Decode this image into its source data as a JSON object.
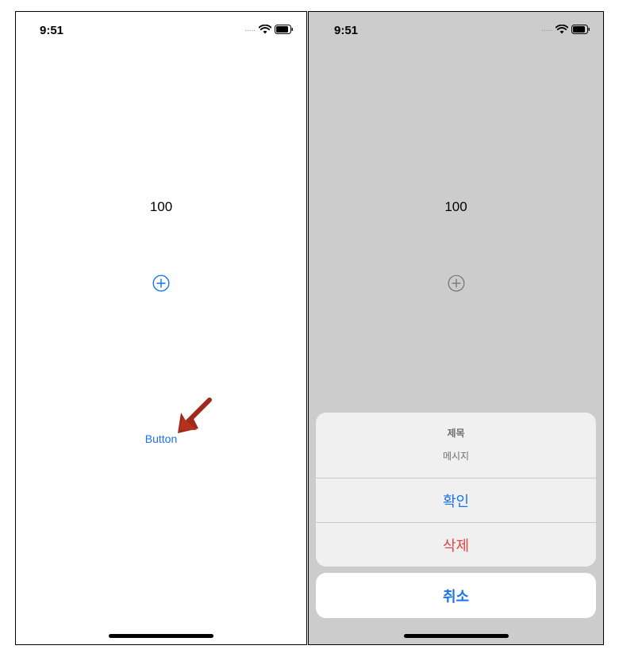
{
  "left_screen": {
    "status_bar": {
      "time": "9:51",
      "signal": "....."
    },
    "counter_value": "100",
    "plus_icon": "plus-circle-icon",
    "button_label": "Button",
    "annotation": "red-arrow-icon"
  },
  "right_screen": {
    "status_bar": {
      "time": "9:51",
      "signal": "....."
    },
    "counter_value": "100",
    "plus_icon": "plus-circle-icon",
    "action_sheet": {
      "title": "제목",
      "message": "메시지",
      "actions": [
        {
          "label": "확인",
          "style": "default"
        },
        {
          "label": "삭제",
          "style": "destructive"
        }
      ],
      "cancel": {
        "label": "취소",
        "style": "cancel"
      }
    }
  },
  "colors": {
    "tint": "#1a73e8",
    "destructive": "#e0443e",
    "dimmed_background": "#cccccc",
    "annotation": "#a0281c"
  }
}
